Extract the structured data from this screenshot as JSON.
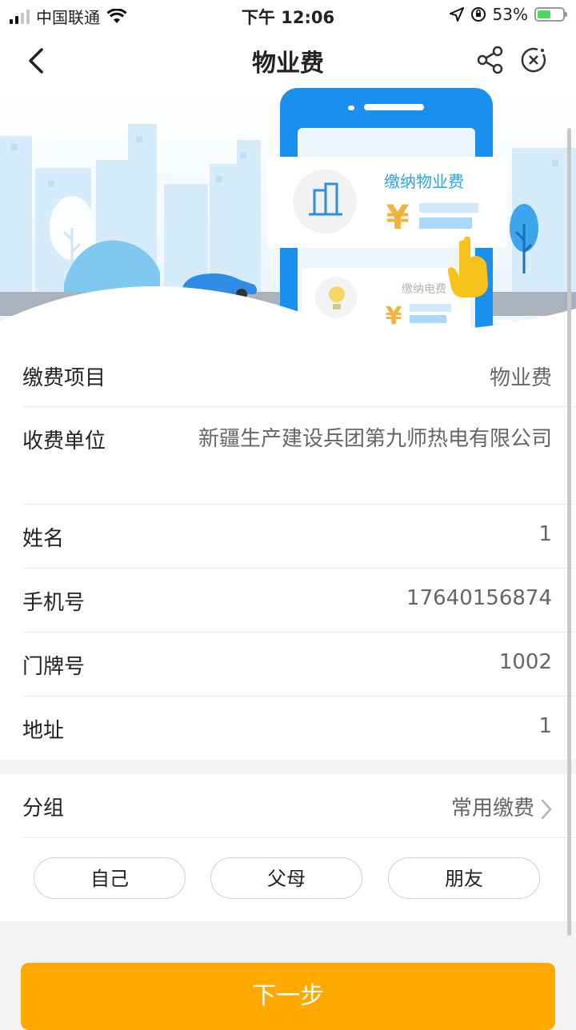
{
  "status_bar": {
    "carrier": "中国联通",
    "time": "下午 12:06",
    "battery_percent": "53%",
    "battery_level": 0.53
  },
  "navbar": {
    "title": "物业费"
  },
  "banner": {
    "card_main_title": "缴纳物业费",
    "card_main_currency": "¥",
    "card_secondary_title": "缴纳电费",
    "card_secondary_currency": "¥"
  },
  "details": [
    {
      "label": "缴费项目",
      "value": "物业费"
    },
    {
      "label": "收费单位",
      "value": "新疆生产建设兵团第九师热电有限公司"
    },
    {
      "label": "姓名",
      "value": "1"
    },
    {
      "label": "手机号",
      "value": "17640156874"
    },
    {
      "label": "门牌号",
      "value": "1002"
    },
    {
      "label": "地址",
      "value": "1"
    }
  ],
  "group": {
    "label": "分组",
    "value": "常用缴费",
    "chips": [
      "自己",
      "父母",
      "朋友"
    ]
  },
  "next_button": "下一步",
  "colors": {
    "accent": "#ffa800",
    "blue": "#2aa3ef"
  }
}
